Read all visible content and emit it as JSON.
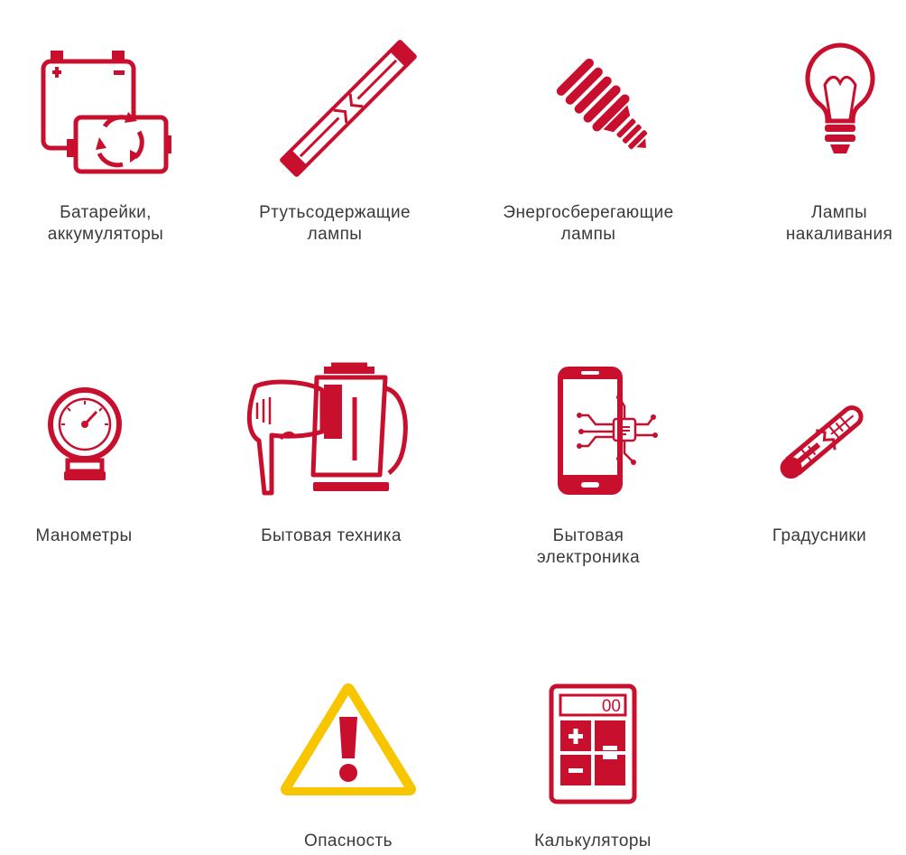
{
  "brand_color": "#c8102e",
  "warning_color": "#f7c600",
  "calculator_display": "00",
  "items": [
    {
      "label_lines": [
        "Батарейки,",
        "аккумуляторы"
      ],
      "icon": "battery-recycle-icon"
    },
    {
      "label_lines": [
        "Ртутьсодержащие",
        "лампы"
      ],
      "icon": "fluorescent-tube-icon"
    },
    {
      "label_lines": [
        "Энергосберегающие",
        "лампы"
      ],
      "icon": "energy-saving-bulb-icon"
    },
    {
      "label_lines": [
        "Лампы",
        "накаливания"
      ],
      "icon": "incandescent-bulb-icon"
    },
    {
      "label_lines": [
        "Манометры"
      ],
      "icon": "pressure-gauge-icon"
    },
    {
      "label_lines": [
        "Бытовая техника"
      ],
      "icon": "hairdryer-kettle-icon"
    },
    {
      "label_lines": [
        "Бытовая",
        "электроника"
      ],
      "icon": "smartphone-chip-icon"
    },
    {
      "label_lines": [
        "Градусники"
      ],
      "icon": "broken-thermometer-icon"
    },
    {
      "label_lines": [
        "Опасность"
      ],
      "icon": "warning-icon"
    },
    {
      "label_lines": [
        "Калькуляторы"
      ],
      "icon": "calculator-icon"
    }
  ]
}
